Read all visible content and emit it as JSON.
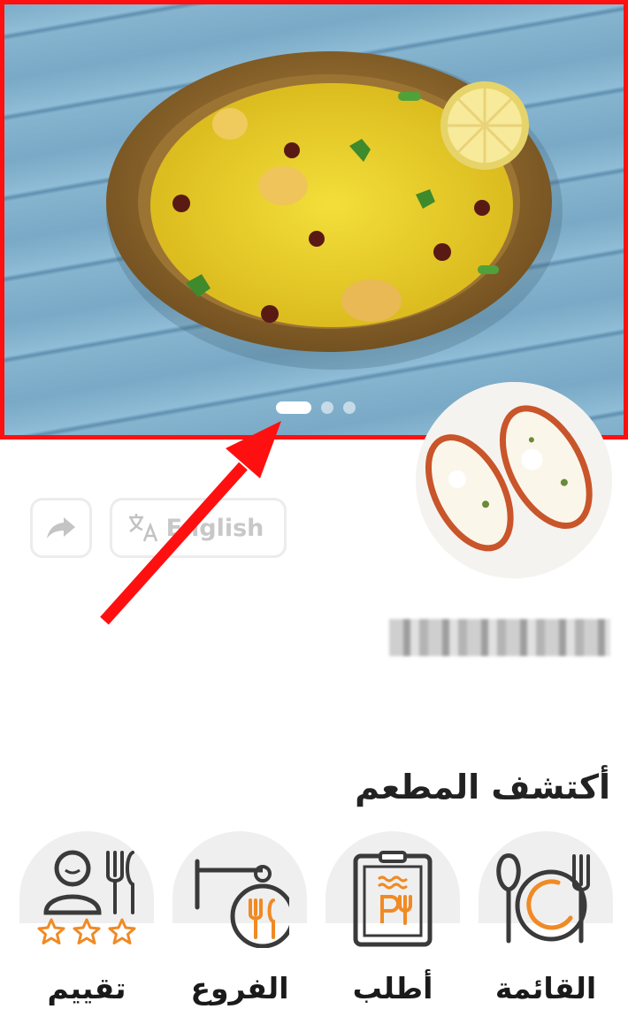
{
  "carousel": {
    "total_slides": 3,
    "active_index": 0
  },
  "header": {
    "language_label": "English",
    "restaurant_name": ""
  },
  "discover": {
    "title": "أكتشف المطعم",
    "items": [
      {
        "label": "القائمة",
        "icon": "plate-cutlery-icon"
      },
      {
        "label": "أطلب",
        "icon": "order-menu-icon"
      },
      {
        "label": "الفروع",
        "icon": "branches-icon"
      },
      {
        "label": "تقييم",
        "icon": "rating-icon"
      }
    ]
  },
  "colors": {
    "accent": "#f08a24",
    "annotation": "#ff1010",
    "icon_stroke": "#3a3a3a"
  }
}
